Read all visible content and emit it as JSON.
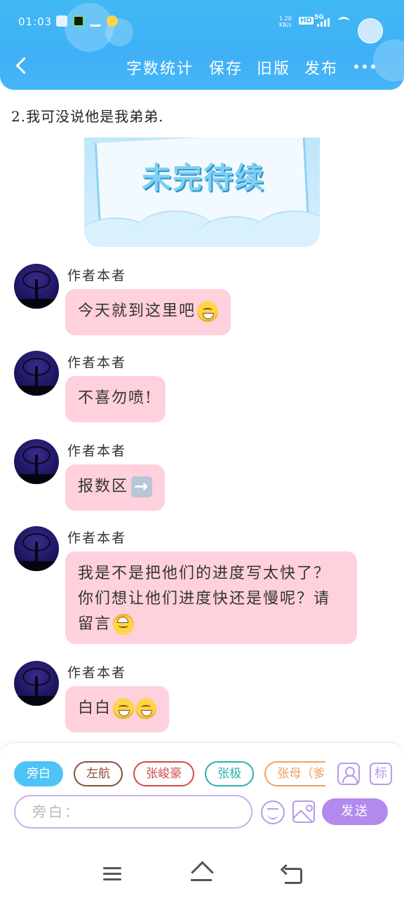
{
  "status_bar": {
    "time": "01:03",
    "network_speed": "1.20\nKB/s",
    "hd": "HD",
    "network_type": "5G"
  },
  "navbar": {
    "back_icon": "back-arrow-icon",
    "actions": [
      "字数统计",
      "保存",
      "旧版",
      "发布"
    ],
    "more_icon": "more-dots-icon"
  },
  "story": {
    "narration": "2.我可没说他是我弟弟.",
    "banner_text": "未完待续"
  },
  "messages": [
    {
      "author": "作者本者",
      "text": "今天就到这里吧",
      "emoji": "grinning-face"
    },
    {
      "author": "作者本者",
      "text": "不喜勿喷!",
      "emoji": ""
    },
    {
      "author": "作者本者",
      "text": "报数区",
      "emoji": "right-arrow"
    },
    {
      "author": "作者本者",
      "text": "我是不是把他们的进度写太快了？你们想让他们进度快还是慢呢？请留言",
      "emoji": "upside-down-face"
    },
    {
      "author": "作者本者",
      "text": "白白",
      "emoji": "grinning-face-x2"
    }
  ],
  "composer": {
    "roles": [
      "旁白",
      "左航",
      "张峻豪",
      "张极",
      "张母（爹"
    ],
    "role_colors": [
      "#4fc3f7",
      "#8a4b3a",
      "#d14a4a",
      "#28b3a7",
      "#f0a060"
    ],
    "active_role": "旁白",
    "input_placeholder": "旁白：",
    "mark_label": "标",
    "send_label": "发送"
  },
  "colors": {
    "header": "#40b8f4",
    "bubble": "#ffd1dc",
    "accent": "#b389ee"
  }
}
